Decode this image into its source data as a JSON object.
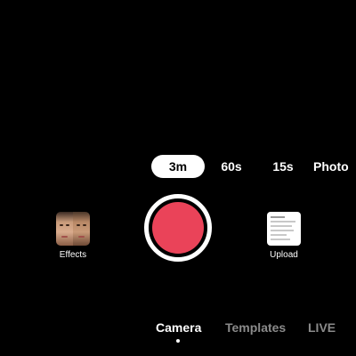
{
  "duration": {
    "options": [
      "3m",
      "60s",
      "15s",
      "Photo"
    ],
    "selected": "3m"
  },
  "effects": {
    "label": "Effects",
    "icon": "effects-thumbnail-faces"
  },
  "record": {
    "color": "#ea4359"
  },
  "upload": {
    "label": "Upload",
    "icon": "gallery-thumbnail"
  },
  "modes": {
    "tabs": [
      "Camera",
      "Templates",
      "LIVE"
    ],
    "selected": "Camera"
  }
}
